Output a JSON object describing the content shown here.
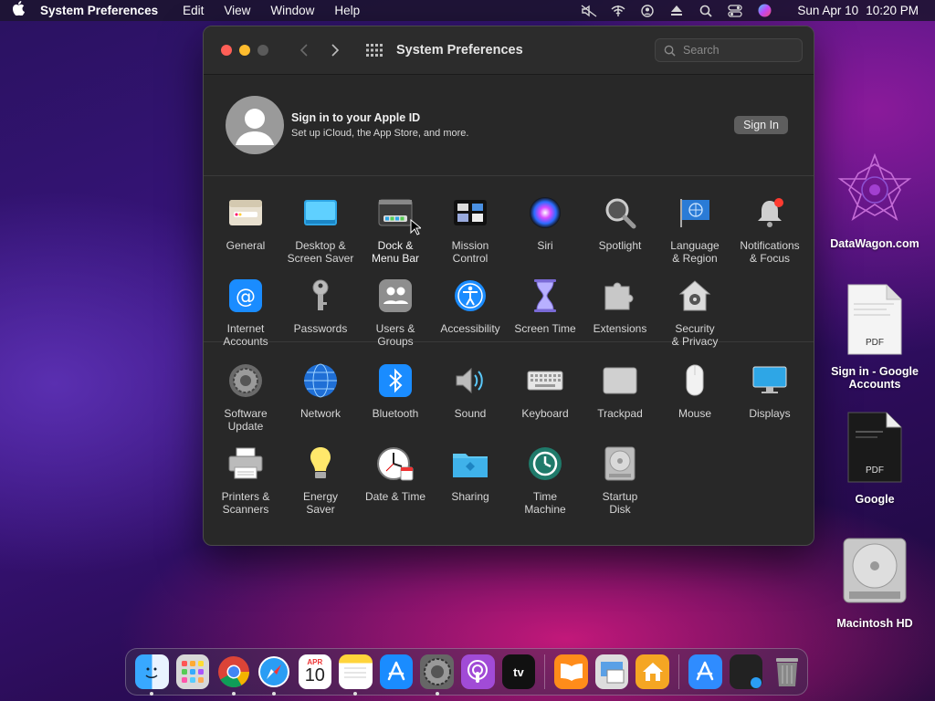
{
  "menubar": {
    "app_name": "System Preferences",
    "items": [
      "Edit",
      "View",
      "Window",
      "Help"
    ],
    "date": "Sun Apr 10",
    "time": "10:20 PM"
  },
  "window": {
    "title": "System Preferences",
    "search_placeholder": "Search"
  },
  "account": {
    "title": "Sign in to your Apple ID",
    "subtitle": "Set up iCloud, the App Store, and more.",
    "button": "Sign In"
  },
  "prefs_row1": [
    "General",
    "Desktop &\nScreen Saver",
    "Dock &\nMenu Bar",
    "Mission\nControl",
    "Siri",
    "Spotlight",
    "Language\n& Region",
    "Notifications\n& Focus"
  ],
  "prefs_row2": [
    "Internet\nAccounts",
    "Passwords",
    "Users &\nGroups",
    "Accessibility",
    "Screen Time",
    "Extensions",
    "Security\n& Privacy"
  ],
  "prefs_row3": [
    "Software\nUpdate",
    "Network",
    "Bluetooth",
    "Sound",
    "Keyboard",
    "Trackpad",
    "Mouse",
    "Displays"
  ],
  "prefs_row4": [
    "Printers &\nScanners",
    "Energy\nSaver",
    "Date & Time",
    "Sharing",
    "Time\nMachine",
    "Startup\nDisk"
  ],
  "desktop": {
    "datawagon": "DataWagon.com",
    "signin_pdf": "Sign in - Google\nAccounts",
    "google_pdf": "Google",
    "pdf_badge": "PDF",
    "hd": "Macintosh HD"
  },
  "dock": {
    "calendar_month": "APR",
    "calendar_day": "10",
    "tv_label": "tv"
  }
}
